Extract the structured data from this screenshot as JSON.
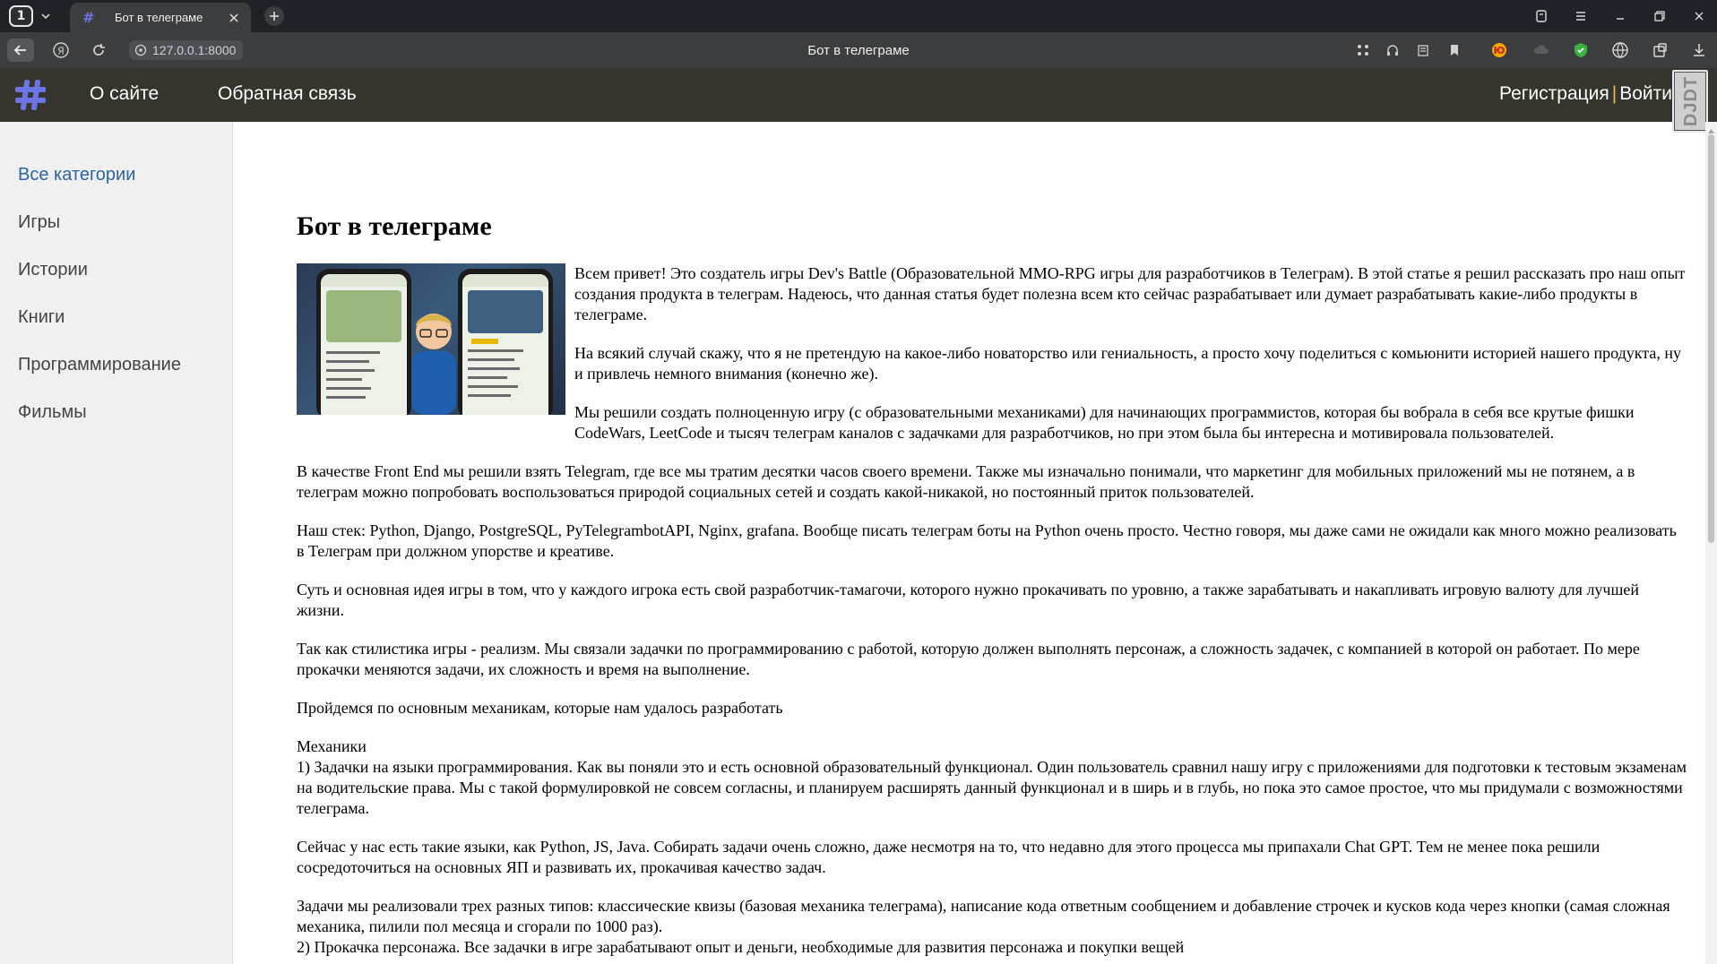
{
  "browser": {
    "tab_counter": "1",
    "tab_title": "Бот в телеграме",
    "url": "127.0.0.1:8000",
    "page_title": "Бот в телеграме"
  },
  "header": {
    "nav": [
      "О сайте",
      "Обратная связь"
    ],
    "register": "Регистрация",
    "separator": "|",
    "login": "Войти",
    "debug_toolbar": "DJDT",
    "colors": {
      "header_bg": "#35352d",
      "logo": "#6d74e6",
      "separator": "#e6c04a"
    }
  },
  "sidebar": {
    "items": [
      "Все категории",
      "Игры",
      "Истории",
      "Книги",
      "Программирование",
      "Фильмы"
    ],
    "active_index": 0,
    "colors": {
      "active": "#2b63a6"
    }
  },
  "article": {
    "title": "Бот в телеграме",
    "paragraphs": [
      "Всем привет! Это создатель игры Dev's Battle (Образовательной MMO-RPG игры для разработчиков в Телеграм). В этой статье я решил рассказать про наш опыт создания продукта в телеграм. Надеюсь, что данная статья будет полезна всем кто сейчас разрабатывает или думает разрабатывать какие-либо продукты в телеграме.",
      "На всякий случай скажу, что я не претендую на какое-либо новаторство или гениальность, а просто хочу поделиться с комьюнити историей нашего продукта, ну и привлечь немного внимания (конечно же).",
      "Мы решили создать полноценную игру (с образовательными механиками) для начинающих программистов, которая бы вобрала в себя все крутые фишки CodeWars, LeetCode и тысяч телеграм каналов с задачками для разработчиков, но при этом была бы интересна и мотивировала пользователей.",
      "В качестве Front End мы решили взять Telegram, где все мы тратим десятки часов своего времени. Также мы изначально понимали, что маркетинг для мобильных приложений мы не потянем, а в телеграм можно попробовать воспользоваться природой социальных сетей и создать какой-никакой, но постоянный приток пользователей.",
      "Наш стек: Python, Django, PostgreSQL, PyTelegrambotAPI, Nginx, grafana. Вообще писать телеграм боты на Python очень просто. Честно говоря, мы даже сами не ожидали как много можно реализовать в Телеграм при должном упорстве и креативе.",
      "Суть и основная идея игры в том, что у каждого игрока есть свой разработчик-тамагочи, которого нужно прокачивать по уровню, а также зарабатывать и накапливать игровую валюту для лучшей жизни.",
      "Так как стилистика игры - реализм. Мы связали задачки по программированию с работой, которую должен выполнять персонаж, а сложность задачек, с компанией в которой он работает. По мере прокачки меняются задачи, их сложность и время на выполнение.",
      "Пройдемся по основным механикам, которые нам удалось разработать"
    ],
    "mechanics_heading": "Механики",
    "mechanics_p1": "1) Задачки на языки программирования. Как вы поняли это и есть основной образовательный функционал. Один пользователь сравнил нашу игру с приложениями для подготовки к тестовым экзаменам на водительские права. Мы с такой формулировкой не совсем согласны, и планируем расширять данный функционал и в ширь и в глубь, но пока это самое простое, что мы придумали с возможностями телеграма.",
    "paragraph_after": "Сейчас у нас есть такие языки, как Python, JS, Java. Собирать задачи очень сложно, даже несмотря на то, что недавно для этого процесса мы припахали Chat GPT. Тем не менее пока решили сосредоточиться на основных ЯП и развивать их, прокачивая качество задач.",
    "paragraph_types": "Задачи мы реализовали трех разных типов: классические квизы (базовая механика телеграма), написание кода ответным сообщением и добавление строчек и кусков кода через кнопки (самая сложная механика, пилили пол месяца и сгорали по 1000 раз).",
    "paragraph_cut": "2) Прокачка персонажа. Все задачки в игре зарабатывают опыт и деньги, необходимые для развития персонажа и покупки вещей"
  }
}
